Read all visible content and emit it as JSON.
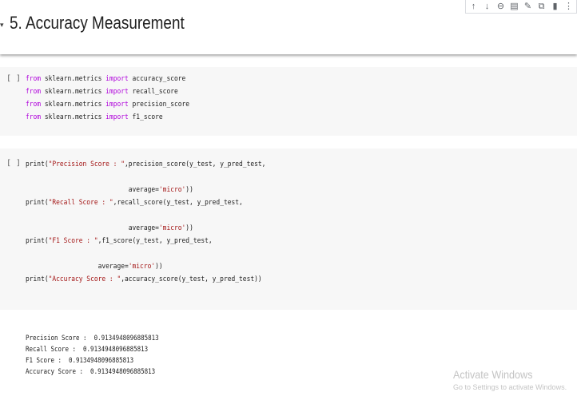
{
  "heading": {
    "caret": "▾",
    "title": "5. Accuracy Measurement"
  },
  "toolbar_icons": [
    "arrow-up-icon",
    "arrow-down-icon",
    "link-icon",
    "comment-icon",
    "edit-icon",
    "mirror-cell-icon",
    "delete-icon",
    "more-icon"
  ],
  "cells": [
    {
      "run_label": "[ ]",
      "lines": [
        {
          "kw1": "from",
          "mod": " sklearn.metrics ",
          "kw2": "import",
          "name": " accuracy_score"
        },
        {
          "kw1": "from",
          "mod": " sklearn.metrics ",
          "kw2": "import",
          "name": " recall_score"
        },
        {
          "kw1": "from",
          "mod": " sklearn.metrics ",
          "kw2": "import",
          "name": " precision_score"
        },
        {
          "kw1": "from",
          "mod": " sklearn.metrics ",
          "kw2": "import",
          "name": " f1_score"
        }
      ]
    },
    {
      "run_label": "[ ]",
      "prints": [
        {
          "fn": "print(",
          "str": "\"Precision Score : \"",
          "call": ",precision_score(y_test, y_pred_test,",
          "indent": "                           ",
          "arg": "average=",
          "argval": "'micro'",
          "close": "))"
        },
        {
          "fn": "print(",
          "str": "\"Recall Score : \"",
          "call": ",recall_score(y_test, y_pred_test,",
          "indent": "                           ",
          "arg": "average=",
          "argval": "'micro'",
          "close": "))"
        },
        {
          "fn": "print(",
          "str": "\"F1 Score : \"",
          "call": ",f1_score(y_test, y_pred_test,",
          "indent": "                   ",
          "arg": "average=",
          "argval": "'micro'",
          "close": "))"
        }
      ],
      "last_print": {
        "fn": "print(",
        "str": "\"Accuracy Score : \"",
        "call": ",accuracy_score(y_test, y_pred_test))"
      }
    }
  ],
  "output_lines": [
    "Precision Score :  0.9134948096885813",
    "Recall Score :  0.9134948096885813",
    "F1 Score :  0.9134948096885813",
    "Accuracy Score :  0.9134948096885813"
  ],
  "watermark": {
    "title": "Activate Windows",
    "subtitle": "Go to Settings to activate Windows."
  },
  "colors": {
    "keyword": "#af00db",
    "string": "#a31515",
    "cell_bg": "#f7f7f7"
  }
}
